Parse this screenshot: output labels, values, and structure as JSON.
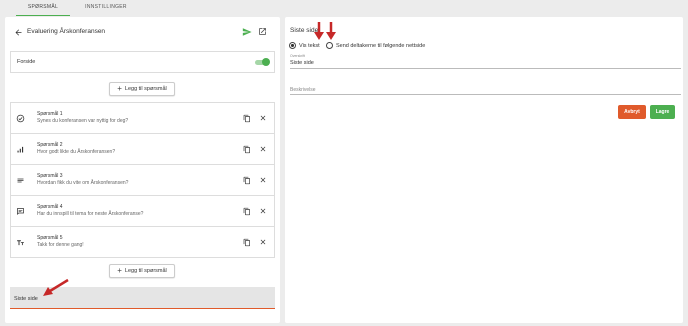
{
  "tabs": [
    {
      "label": "SPØRSMÅL",
      "active": true
    },
    {
      "label": "INNSTILLINGER",
      "active": false
    }
  ],
  "left": {
    "title": "Evaluering Årskonferansen",
    "forside_label": "Forside",
    "forside_enabled": true,
    "add_question_label": "Legg til spørsmål",
    "questions": [
      {
        "icon": "check-circle-icon",
        "title": "Spørsmål 1",
        "text": "Synes du konferansen var nyttig for deg?"
      },
      {
        "icon": "bar-chart-icon",
        "title": "Spørsmål 2",
        "text": "Hvor godt likte du Årskonferansen?"
      },
      {
        "icon": "list-lines-icon",
        "title": "Spørsmål 3",
        "text": "Hvordan fikk du vite om Årskonferansen?"
      },
      {
        "icon": "comment-icon",
        "title": "Spørsmål 4",
        "text": "Har du innspill til tema for neste Årskonferanse?"
      },
      {
        "icon": "text-format-icon",
        "title": "Spørsmål 5",
        "text": "Takk for denne gang!"
      }
    ],
    "last_page_label": "Siste side"
  },
  "right": {
    "title": "Siste side",
    "radio_options": [
      {
        "label": "Vis tekst",
        "selected": true
      },
      {
        "label": "Send deltakerne til følgende nettside",
        "selected": false
      }
    ],
    "field_title_label": "Overskrift",
    "field_title_value": "Siste side",
    "field_desc_placeholder": "Beskrivelse",
    "cancel_label": "Avbryt",
    "save_label": "Lagre"
  },
  "colors": {
    "accent_green": "#4caf50",
    "accent_orange": "#e05a2b",
    "annotation_red": "#c62828"
  }
}
